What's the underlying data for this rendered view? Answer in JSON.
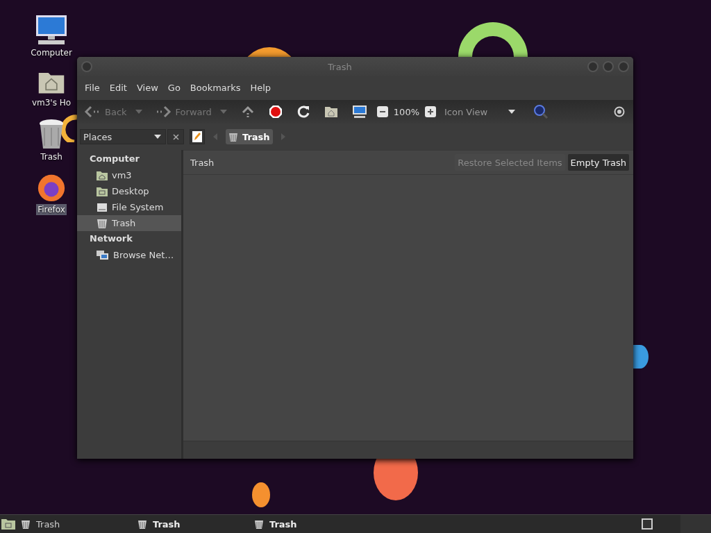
{
  "desktop_icons": [
    {
      "label": "Computer",
      "kind": "computer",
      "selected": false
    },
    {
      "label": "vm3's Ho",
      "kind": "home",
      "selected": false
    },
    {
      "label": "Trash",
      "kind": "trash",
      "selected": false
    },
    {
      "label": "Firefox",
      "kind": "browser",
      "selected": true
    }
  ],
  "window": {
    "title": "Trash"
  },
  "menu": [
    "File",
    "Edit",
    "View",
    "Go",
    "Bookmarks",
    "Help"
  ],
  "toolbar": {
    "back": {
      "label": "Back",
      "disabled": true
    },
    "forward": {
      "label": "Forward",
      "disabled": true
    },
    "zoom": "100%",
    "view": "Icon View"
  },
  "location": {
    "crumb": "Trash"
  },
  "sidebar": {
    "title": "Places",
    "sections": [
      {
        "heading": "Computer",
        "items": [
          {
            "label": "vm3",
            "kind": "home",
            "selected": false
          },
          {
            "label": "Desktop",
            "kind": "desktop",
            "selected": false
          },
          {
            "label": "File System",
            "kind": "drive",
            "selected": false
          },
          {
            "label": "Trash",
            "kind": "trash",
            "selected": true
          }
        ]
      },
      {
        "heading": "Network",
        "items": [
          {
            "label": "Browse Net…",
            "kind": "network",
            "selected": false
          }
        ]
      }
    ]
  },
  "content": {
    "title": "Trash",
    "buttons": [
      {
        "label": "Restore Selected Items",
        "disabled": true
      },
      {
        "label": "Empty Trash",
        "disabled": false
      }
    ]
  },
  "taskbar": {
    "tasks": [
      {
        "label": "Trash",
        "active": false
      },
      {
        "label": "Trash",
        "active": true
      },
      {
        "label": "Trash",
        "active": true
      }
    ]
  }
}
